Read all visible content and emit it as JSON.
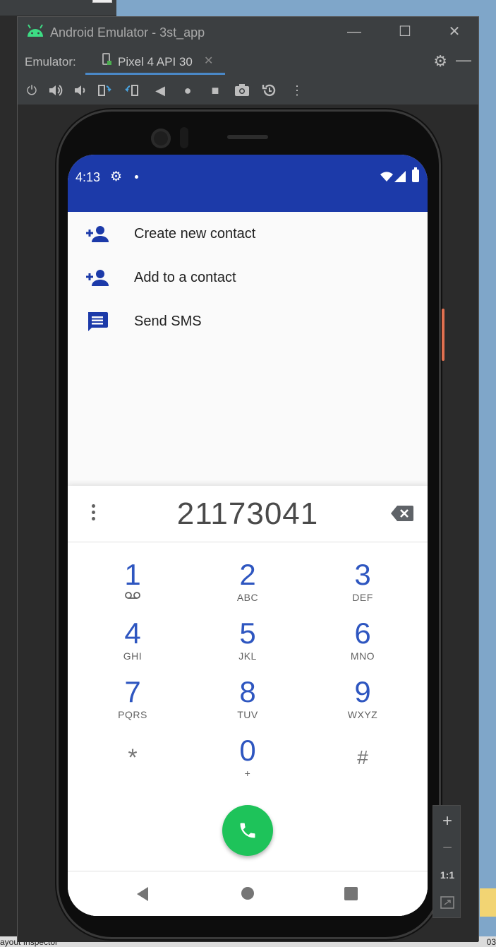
{
  "window": {
    "title": "Android Emulator - 3st_app",
    "minimize": "—",
    "maximize": "☐",
    "close": "✕"
  },
  "tabs": {
    "emulator_label": "Emulator:",
    "device_tab": "Pixel 4 API 30",
    "device_close": "✕"
  },
  "toolbar": {
    "icons": [
      "power-icon",
      "volume-up-icon",
      "volume-down-icon",
      "rotate-left-icon",
      "rotate-right-icon",
      "back-icon",
      "home-icon",
      "overview-icon",
      "screenshot-icon",
      "snapshot-icon",
      "more-icon"
    ]
  },
  "status_bar": {
    "time": "4:13"
  },
  "menu": {
    "items": [
      {
        "label": "Create new contact",
        "icon": "person-add-icon"
      },
      {
        "label": "Add to a contact",
        "icon": "person-add-icon"
      },
      {
        "label": "Send SMS",
        "icon": "message-icon"
      }
    ]
  },
  "dialer": {
    "number": "21173041",
    "keys": [
      {
        "num": "1",
        "letters": ""
      },
      {
        "num": "2",
        "letters": "ABC"
      },
      {
        "num": "3",
        "letters": "DEF"
      },
      {
        "num": "4",
        "letters": "GHI"
      },
      {
        "num": "5",
        "letters": "JKL"
      },
      {
        "num": "6",
        "letters": "MNO"
      },
      {
        "num": "7",
        "letters": "PQRS"
      },
      {
        "num": "8",
        "letters": "TUV"
      },
      {
        "num": "9",
        "letters": "WXYZ"
      },
      {
        "num": "*",
        "letters": ""
      },
      {
        "num": "0",
        "letters": "+"
      },
      {
        "num": "#",
        "letters": ""
      }
    ]
  },
  "zoom": {
    "plus": "+",
    "minus": "−",
    "one_to_one": "1:1"
  },
  "ide": {
    "bottom_left": "ayout Inspector",
    "bottom_right": "03"
  },
  "colors": {
    "status_bar": "#1c3aa9",
    "key_digit": "#2e56c0",
    "call_button": "#1ec35a"
  }
}
